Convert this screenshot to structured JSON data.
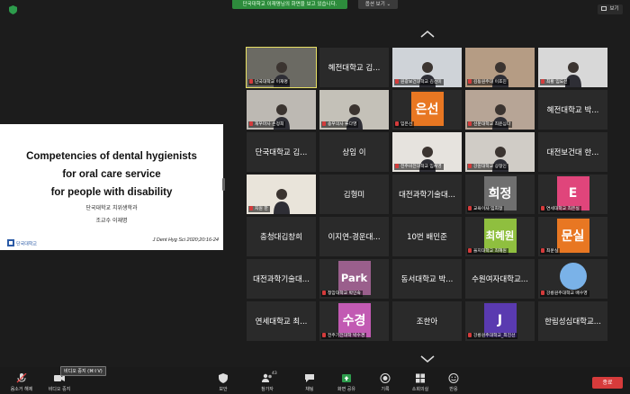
{
  "banner": {
    "text": "단국대학교 이재명님의 화면을 보고 있습니다.",
    "view_options": "옵션 보기 ⌄",
    "view_button": "보기"
  },
  "slide": {
    "title_lines": [
      "Competencies of dental hygienists",
      "for oral care service",
      "for people with disability"
    ],
    "dept": "단국대학교 치위생학과",
    "authors": "조교수 이재명",
    "reference": "J Dent Hyg Sci 2020;20:16-24",
    "logo_text": "단국대학교"
  },
  "gallery": {
    "tiles": [
      {
        "type": "video",
        "label": "단국대학교 이재명",
        "active": true,
        "bg": "#6b6a63"
      },
      {
        "type": "name",
        "name": "혜전대학교 김..."
      },
      {
        "type": "video",
        "label": "원광보건대학교 김선미",
        "bg": "#cfd3d8"
      },
      {
        "type": "video",
        "label": "김동원주대 이호진",
        "bg": "#b59c84"
      },
      {
        "type": "video",
        "label": "최황 임도선",
        "bg": "#d8d8d8"
      },
      {
        "type": "video",
        "label": "재우마사 손정희",
        "bg": "#bdb9b3"
      },
      {
        "type": "video",
        "label": "송우의사 류다영",
        "bg": "#c4c1b8"
      },
      {
        "type": "avatar",
        "avatar_text": "은선",
        "color": "#e87722",
        "label": "임은선"
      },
      {
        "type": "video",
        "label": "선문대학교 최윤심다",
        "bg": "#b7a596"
      },
      {
        "type": "name",
        "name": "혜전대학교 박..."
      },
      {
        "type": "name",
        "name": "단국대학교 김..."
      },
      {
        "type": "name",
        "name": "상임 이"
      },
      {
        "type": "video",
        "label": "전주비전대학교 임채영",
        "bg": "#e6e3de"
      },
      {
        "type": "video",
        "label": "강원대학교 상정인",
        "bg": "#d0ccc6"
      },
      {
        "type": "name",
        "name": "대전보건대 한..."
      },
      {
        "type": "video",
        "label": "지원 한",
        "bg": "#e9e4da"
      },
      {
        "type": "name",
        "name": "김형미"
      },
      {
        "type": "name",
        "name": "대전과학기술대..."
      },
      {
        "type": "avatar",
        "avatar_text": "희정",
        "color": "#6f6f6f",
        "label": "교육이사 임희정"
      },
      {
        "type": "avatar",
        "avatar_text": "E",
        "color": "#e0457b",
        "label": "연세대학교 최은실"
      },
      {
        "type": "name",
        "name": "충청대김창희"
      },
      {
        "type": "name",
        "name": "이지연-경운대..."
      },
      {
        "type": "name",
        "name": "10번 배민준"
      },
      {
        "type": "avatar",
        "avatar_text": "최혜원",
        "color": "#8fbf3f",
        "label": "을지대학교 최혜원",
        "small": true
      },
      {
        "type": "avatar",
        "avatar_text": "문실",
        "color": "#e87722",
        "label": "최문실"
      },
      {
        "type": "name",
        "name": "대전과학기술대..."
      },
      {
        "type": "avatar",
        "avatar_text": "Park",
        "color": "#9a5f8c",
        "label": "청암대학교 박인숙",
        "small": true
      },
      {
        "type": "name",
        "name": "동서대학교 박..."
      },
      {
        "type": "name",
        "name": "수원여자대학교..."
      },
      {
        "type": "avatar",
        "avatar_text": "",
        "color": "#7ab2e8",
        "label": "강릉원주대학교 배수영",
        "circle": true
      },
      {
        "type": "name",
        "name": "연세대학교 최..."
      },
      {
        "type": "avatar",
        "avatar_text": "수경",
        "color": "#c25ab3",
        "label": "전주기전대학 박수경"
      },
      {
        "type": "name",
        "name": "조한아"
      },
      {
        "type": "avatar",
        "avatar_text": "J",
        "color": "#5a3ab0",
        "label": "강릉원주대학교_최진선"
      },
      {
        "type": "name",
        "name": "한림성심대학교..."
      }
    ]
  },
  "toolbar": {
    "audio": "음소거 해제",
    "video": "비디오 중지",
    "tooltip": "비디오 중지 (⌘⇧V)",
    "security": "보안",
    "participants": "참가자",
    "participants_count": "43",
    "chat": "채팅",
    "share": "화면 공유",
    "record": "기록",
    "rooms": "소회의실",
    "reactions": "반응",
    "end": "종료"
  },
  "colors": {
    "share_green": "#2d8c3c",
    "end_red": "#d63b3b",
    "active_border": "#e8e063"
  }
}
